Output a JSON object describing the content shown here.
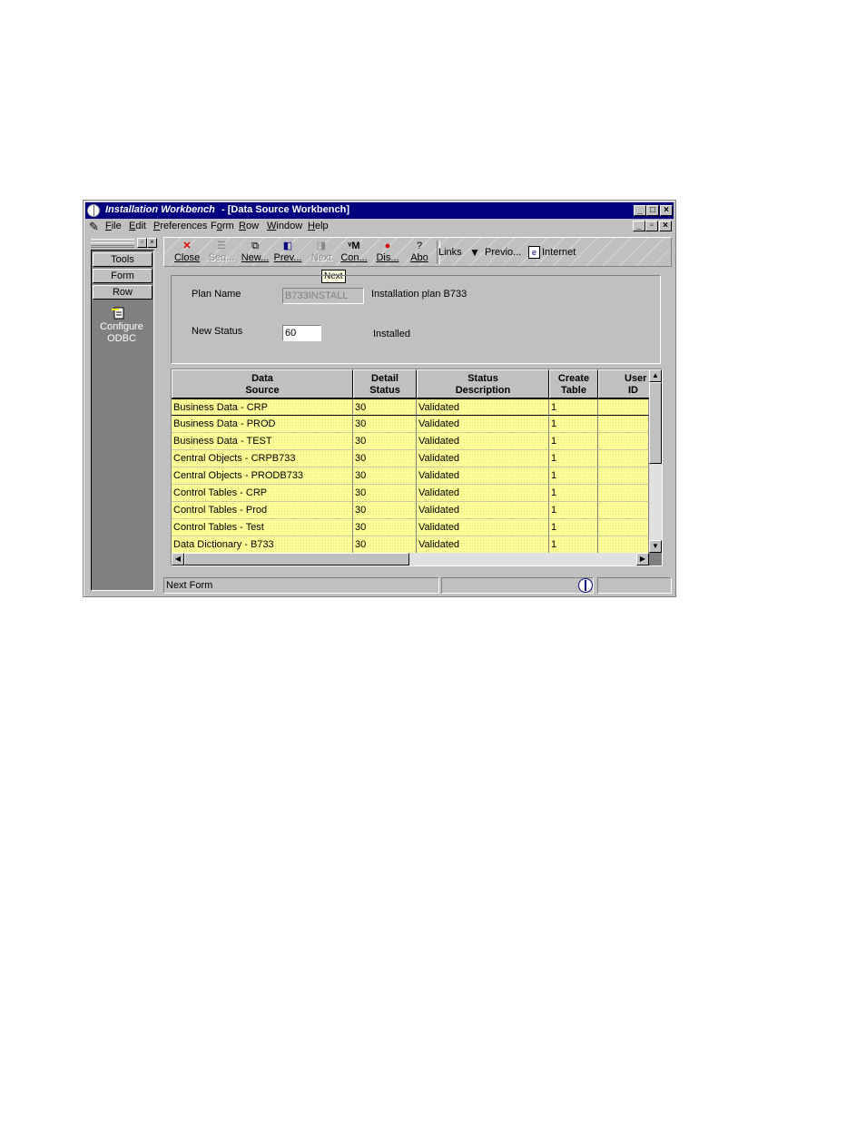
{
  "window": {
    "app_title": "Installation Workbench",
    "doc_title": "- [Data Source Workbench]"
  },
  "menubar": {
    "items": [
      {
        "label": "File",
        "mnemonic": "F"
      },
      {
        "label": "Edit",
        "mnemonic": "E"
      },
      {
        "label": "Preferences",
        "mnemonic": "P"
      },
      {
        "label": "Form",
        "mnemonic": "o"
      },
      {
        "label": "Row",
        "mnemonic": "R"
      },
      {
        "label": "Window",
        "mnemonic": "W"
      },
      {
        "label": "Help",
        "mnemonic": "H"
      }
    ]
  },
  "left_pane": {
    "buttons": [
      "Tools",
      "Form",
      "Row"
    ],
    "exit_label_line1": "Configure",
    "exit_label_line2": "ODBC"
  },
  "toolbar": {
    "buttons": [
      {
        "label": "Close",
        "icon": "close-icon",
        "enabled": true
      },
      {
        "label": "Seq...",
        "icon": "sequence-icon",
        "enabled": false
      },
      {
        "label": "New...",
        "icon": "new-icon",
        "enabled": true
      },
      {
        "label": "Prev...",
        "icon": "prev-icon",
        "enabled": true
      },
      {
        "label": "Next",
        "icon": "next-icon",
        "enabled": false
      },
      {
        "label": "Con...",
        "icon": "configure-icon",
        "enabled": true
      },
      {
        "label": "Dis...",
        "icon": "display-icon",
        "enabled": true
      },
      {
        "label": "Abo",
        "icon": "about-icon",
        "enabled": true
      }
    ],
    "links_label": "Links",
    "previous_label": "Previo...",
    "internet_label": "Internet",
    "tooltip": "Next"
  },
  "form": {
    "plan_name_label": "Plan Name",
    "plan_name_value": "B733INSTALL",
    "plan_description": "Installation plan B733",
    "new_status_label": "New Status",
    "new_status_value": "60",
    "new_status_description": "Installed"
  },
  "grid": {
    "columns": [
      {
        "line1": "Data",
        "line2": "Source"
      },
      {
        "line1": "Detail",
        "line2": "Status"
      },
      {
        "line1": "Status",
        "line2": "Description"
      },
      {
        "line1": "Create",
        "line2": "Table"
      },
      {
        "line1": "User",
        "line2": "ID"
      }
    ],
    "rows": [
      [
        "Business Data - CRP",
        "30",
        "Validated",
        "1",
        ""
      ],
      [
        "Business Data - PROD",
        "30",
        "Validated",
        "1",
        ""
      ],
      [
        "Business Data - TEST",
        "30",
        "Validated",
        "1",
        ""
      ],
      [
        "Central Objects - CRPB733",
        "30",
        "Validated",
        "1",
        ""
      ],
      [
        "Central Objects - PRODB733",
        "30",
        "Validated",
        "1",
        ""
      ],
      [
        "Control Tables - CRP",
        "30",
        "Validated",
        "1",
        ""
      ],
      [
        "Control Tables - Prod",
        "30",
        "Validated",
        "1",
        ""
      ],
      [
        "Control Tables - Test",
        "30",
        "Validated",
        "1",
        ""
      ],
      [
        "Data Dictionary - B733",
        "30",
        "Validated",
        "1",
        ""
      ]
    ],
    "row_color": "#ffff99"
  },
  "statusbar": {
    "text": "Next Form"
  },
  "colors": {
    "titlebar": "#000080",
    "face": "#c0c0c0"
  }
}
